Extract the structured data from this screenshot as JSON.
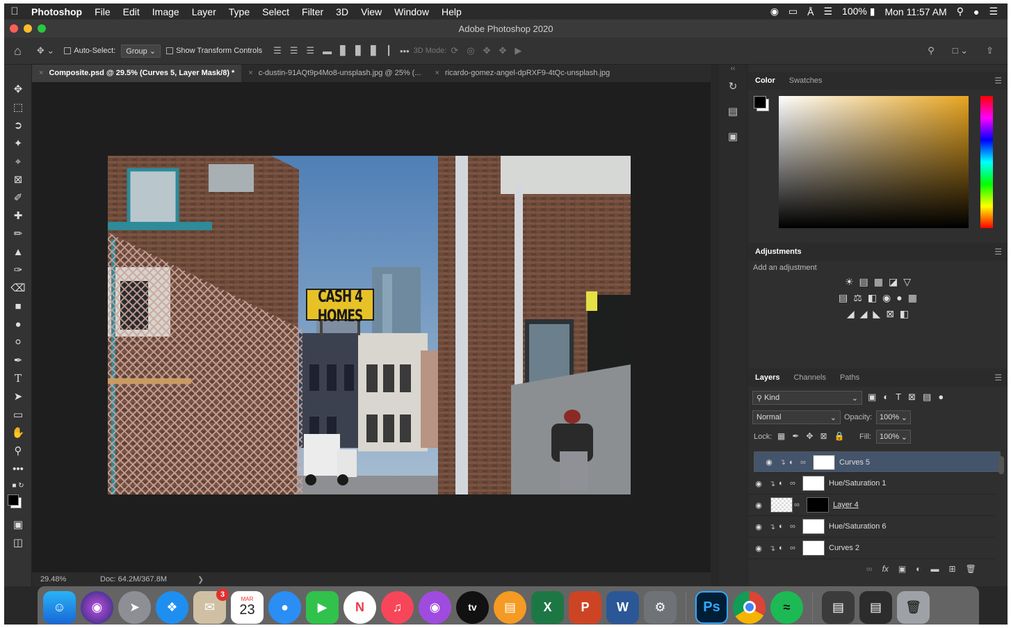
{
  "menubar": {
    "app": "Photoshop",
    "items": [
      "File",
      "Edit",
      "Image",
      "Layer",
      "Type",
      "Select",
      "Filter",
      "3D",
      "View",
      "Window",
      "Help"
    ],
    "battery": "100%",
    "clock": "Mon 11:57 AM"
  },
  "window": {
    "title": "Adobe Photoshop 2020"
  },
  "options": {
    "auto_select_label": "Auto-Select:",
    "auto_select_value": "Group",
    "transform_label": "Show Transform Controls",
    "mode_3d": "3D Mode:"
  },
  "tabs": [
    {
      "label": "Composite.psd @ 29.5% (Curves 5, Layer Mask/8) *"
    },
    {
      "label": "c-dustin-91AQt9p4Mo8-unsplash.jpg @ 25% (..."
    },
    {
      "label": "ricardo-gomez-angel-dpRXF9-4tQc-unsplash.jpg"
    }
  ],
  "artwork": {
    "sign_text": "CASH 4 HOMES"
  },
  "status": {
    "zoom": "29.48%",
    "doc": "Doc: 64.2M/367.8M"
  },
  "color_panel": {
    "tab_color": "Color",
    "tab_swatches": "Swatches"
  },
  "adjustments": {
    "title": "Adjustments",
    "hint": "Add an adjustment"
  },
  "layers_panel": {
    "tab_layers": "Layers",
    "tab_channels": "Channels",
    "tab_paths": "Paths",
    "filter_kind": "Kind",
    "blend_mode": "Normal",
    "opacity_label": "Opacity:",
    "opacity_value": "100%",
    "lock_label": "Lock:",
    "fill_label": "Fill:",
    "fill_value": "100%",
    "layers": [
      {
        "name": "Curves 5"
      },
      {
        "name": "Hue/Saturation 1"
      },
      {
        "name": "Layer 4"
      },
      {
        "name": "Hue/Saturation 6"
      },
      {
        "name": "Curves 2"
      }
    ]
  },
  "dock": {
    "calendar_month": "MAR",
    "calendar_day": "23",
    "mail_badge": "3",
    "ps_label": "Ps"
  },
  "colors": {
    "accent": "#44546a",
    "panel": "#2f2f2f",
    "ps_blue": "#31a8ff"
  }
}
